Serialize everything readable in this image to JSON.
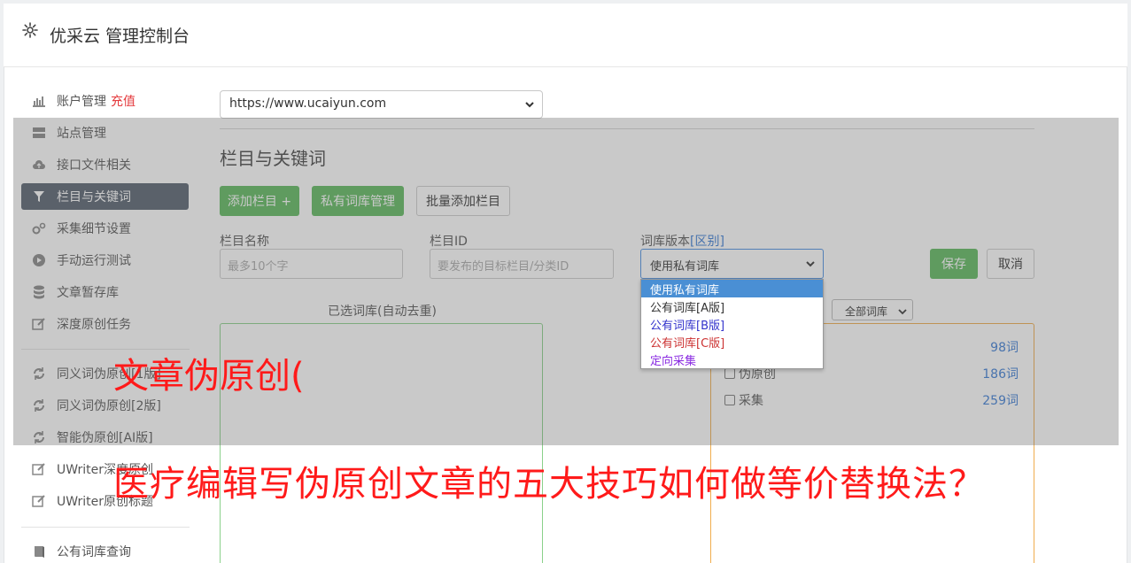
{
  "header": {
    "title": "优采云 管理控制台"
  },
  "sidebar": {
    "items": [
      {
        "label": "账户管理",
        "extra": "充值",
        "icon": "bar-chart-icon"
      },
      {
        "label": "站点管理",
        "icon": "server-icon"
      },
      {
        "label": "接口文件相关",
        "icon": "cloud-upload-icon"
      },
      {
        "label": "栏目与关键词",
        "icon": "filter-icon"
      },
      {
        "label": "采集细节设置",
        "icon": "cogs-icon"
      },
      {
        "label": "手动运行测试",
        "icon": "play-icon"
      },
      {
        "label": "文章暂存库",
        "icon": "database-icon"
      },
      {
        "label": "深度原创任务",
        "icon": "edit-icon"
      },
      {
        "label": "同义词伪原创[1版]",
        "icon": "refresh-icon"
      },
      {
        "label": "同义词伪原创[2版]",
        "icon": "refresh-icon"
      },
      {
        "label": "智能伪原创[AI版]",
        "icon": "refresh-icon"
      },
      {
        "label": "UWriter深度原创",
        "icon": "edit-icon"
      },
      {
        "label": "UWriter原创标题",
        "icon": "edit-icon"
      },
      {
        "label": "公有词库查询",
        "icon": "book-icon"
      }
    ]
  },
  "site_select": {
    "value": "https://www.ucaiyun.com"
  },
  "section": {
    "title": "栏目与关键词"
  },
  "buttons": {
    "add_column": "添加栏目 +",
    "private_lib": "私有词库管理",
    "batch_add": "批量添加栏目",
    "save": "保存",
    "cancel": "取消"
  },
  "form": {
    "column_name_label": "栏目名称",
    "column_name_placeholder": "最多10个字",
    "column_id_label": "栏目ID",
    "column_id_placeholder": "要发布的目标栏目/分类ID",
    "lib_version_label": "词库版本",
    "lib_version_link": "[区别]",
    "lib_version_value": "使用私有词库"
  },
  "dropdown": {
    "options": [
      {
        "label": "使用私有词库",
        "color": "#ffffff"
      },
      {
        "label": "公有词库[A版]",
        "color": "#333333"
      },
      {
        "label": "公有词库[B版]",
        "color": "#3333cc"
      },
      {
        "label": "公有词库[C版]",
        "color": "#cc3333"
      },
      {
        "label": "定向采集",
        "color": "#8a2be2"
      }
    ]
  },
  "selected_box": {
    "title": "已选词库(自动去重)"
  },
  "all_libs_select": {
    "value": "全部词库"
  },
  "libs": [
    {
      "label": "",
      "count": "98词"
    },
    {
      "label": "伪原创",
      "count": "186词"
    },
    {
      "label": "采集",
      "count": "259词"
    }
  ],
  "watermark": {
    "line1": "文章伪原创(",
    "line2": "医疗编辑写伪原创文章的五大技巧如何做等价替换法？"
  }
}
